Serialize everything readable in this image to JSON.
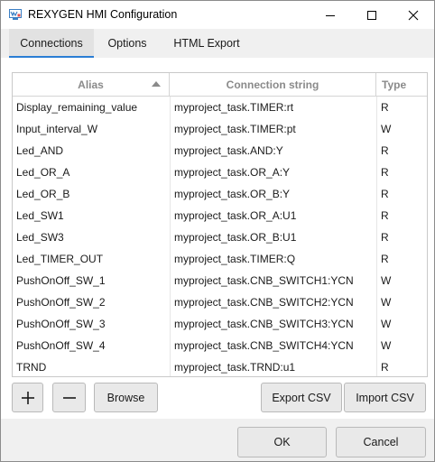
{
  "window": {
    "title": "REXYGEN HMI Configuration"
  },
  "tabs": [
    {
      "label": "Connections"
    },
    {
      "label": "Options"
    },
    {
      "label": "HTML Export"
    }
  ],
  "table": {
    "headers": {
      "alias": "Alias",
      "connection": "Connection string",
      "type": "Type"
    },
    "sort": "Alias ascending",
    "rows": [
      {
        "alias": "Display_remaining_value",
        "connection": "myproject_task.TIMER:rt",
        "type": "R"
      },
      {
        "alias": "Input_interval_W",
        "connection": "myproject_task.TIMER:pt",
        "type": "W"
      },
      {
        "alias": "Led_AND",
        "connection": "myproject_task.AND:Y",
        "type": "R"
      },
      {
        "alias": "Led_OR_A",
        "connection": "myproject_task.OR_A:Y",
        "type": "R"
      },
      {
        "alias": "Led_OR_B",
        "connection": "myproject_task.OR_B:Y",
        "type": "R"
      },
      {
        "alias": "Led_SW1",
        "connection": "myproject_task.OR_A:U1",
        "type": "R"
      },
      {
        "alias": "Led_SW3",
        "connection": "myproject_task.OR_B:U1",
        "type": "R"
      },
      {
        "alias": "Led_TIMER_OUT",
        "connection": "myproject_task.TIMER:Q",
        "type": "R"
      },
      {
        "alias": "PushOnOff_SW_1",
        "connection": "myproject_task.CNB_SWITCH1:YCN",
        "type": "W"
      },
      {
        "alias": "PushOnOff_SW_2",
        "connection": "myproject_task.CNB_SWITCH2:YCN",
        "type": "W"
      },
      {
        "alias": "PushOnOff_SW_3",
        "connection": "myproject_task.CNB_SWITCH3:YCN",
        "type": "W"
      },
      {
        "alias": "PushOnOff_SW_4",
        "connection": "myproject_task.CNB_SWITCH4:YCN",
        "type": "W"
      },
      {
        "alias": "TRND",
        "connection": "myproject_task.TRND:u1",
        "type": "R"
      }
    ]
  },
  "actions": {
    "add": "+",
    "remove": "—",
    "browse": "Browse",
    "export_csv": "Export CSV",
    "import_csv": "Import CSV"
  },
  "footer": {
    "ok": "OK",
    "cancel": "Cancel"
  },
  "colors": {
    "accent": "#2a7dd4",
    "icon_blue": "#3b7fc4"
  }
}
